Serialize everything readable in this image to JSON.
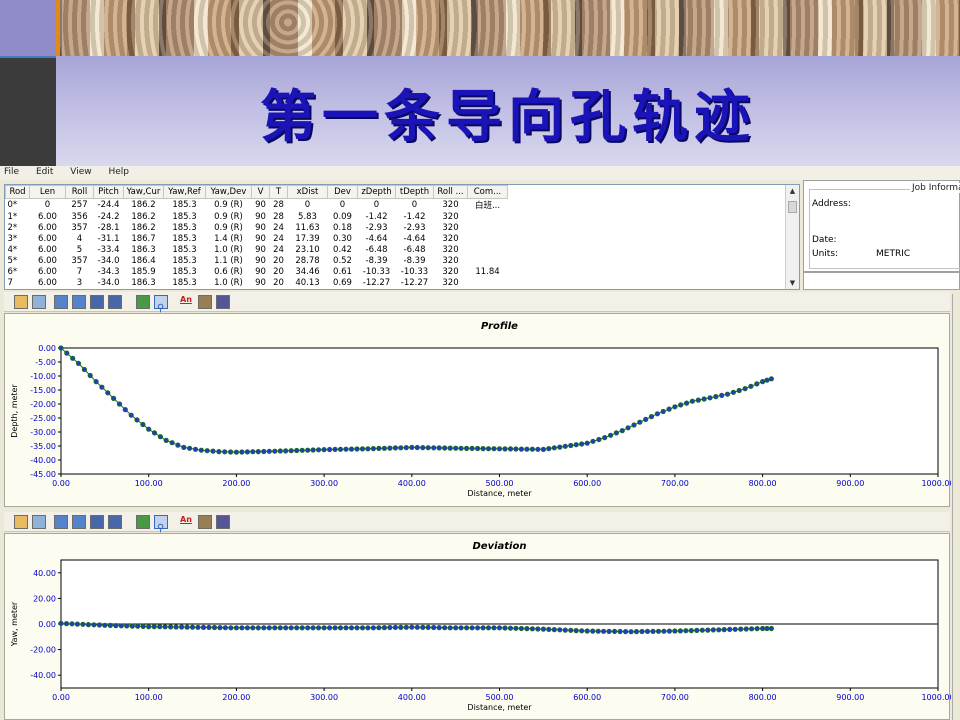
{
  "slide": {
    "title": "第一条导向孔轨迹"
  },
  "menu": {
    "items": [
      "File",
      "Edit",
      "View",
      "Help"
    ]
  },
  "grid": {
    "columns": [
      "Rod",
      "Len",
      "Roll",
      "Pitch",
      "Yaw,Cur",
      "Yaw,Ref",
      "Yaw,Dev",
      "V",
      "T",
      "xDist",
      "Dev",
      "zDepth",
      "tDepth",
      "Roll ...",
      "Com..."
    ],
    "rows": [
      [
        "0*",
        "0",
        "257",
        "-24.4",
        "186.2",
        "185.3",
        "0.9 (R)",
        "90",
        "28",
        "0",
        "0",
        "0",
        "0",
        "320",
        "白班..."
      ],
      [
        "1*",
        "6.00",
        "356",
        "-24.2",
        "186.2",
        "185.3",
        "0.9 (R)",
        "90",
        "28",
        "5.83",
        "0.09",
        "-1.42",
        "-1.42",
        "320",
        ""
      ],
      [
        "2*",
        "6.00",
        "357",
        "-28.1",
        "186.2",
        "185.3",
        "0.9 (R)",
        "90",
        "24",
        "11.63",
        "0.18",
        "-2.93",
        "-2.93",
        "320",
        ""
      ],
      [
        "3*",
        "6.00",
        "4",
        "-31.1",
        "186.7",
        "185.3",
        "1.4 (R)",
        "90",
        "24",
        "17.39",
        "0.30",
        "-4.64",
        "-4.64",
        "320",
        ""
      ],
      [
        "4*",
        "6.00",
        "5",
        "-33.4",
        "186.3",
        "185.3",
        "1.0 (R)",
        "90",
        "24",
        "23.10",
        "0.42",
        "-6.48",
        "-6.48",
        "320",
        ""
      ],
      [
        "5*",
        "6.00",
        "357",
        "-34.0",
        "186.4",
        "185.3",
        "1.1 (R)",
        "90",
        "20",
        "28.78",
        "0.52",
        "-8.39",
        "-8.39",
        "320",
        ""
      ],
      [
        "6*",
        "6.00",
        "7",
        "-34.3",
        "185.9",
        "185.3",
        "0.6 (R)",
        "90",
        "20",
        "34.46",
        "0.61",
        "-10.33",
        "-10.33",
        "320",
        "11.84"
      ],
      [
        "7",
        "6.00",
        "3",
        "-34.0",
        "186.3",
        "185.3",
        "1.0 (R)",
        "90",
        "20",
        "40.13",
        "0.69",
        "-12.27",
        "-12.27",
        "320",
        ""
      ]
    ]
  },
  "job_info": {
    "legend": "Job Informa",
    "address_label": "Address:",
    "date_label": "Date:",
    "units_label": "Units:",
    "units_value": "METRIC"
  },
  "toolbar": {
    "icons": [
      "folder-open-icon",
      "copy-icon",
      "grid-view-icon",
      "grid-view2-icon",
      "table-icon",
      "table2-icon",
      "export-icon",
      "zoom-icon",
      "annotate-icon",
      "hammer-icon",
      "binoculars-icon"
    ],
    "annotate_label": "An"
  },
  "colors": {
    "series_fill": "#1e3fbf",
    "series_stroke": "#1a6b1a",
    "tick_text": "#0000cc"
  },
  "chart_data": [
    {
      "type": "scatter",
      "title": "Profile",
      "xlabel": "Distance, meter",
      "ylabel": "Depth, meter",
      "xlim": [
        0,
        1000
      ],
      "ylim": [
        -45,
        0
      ],
      "x_ticks": [
        "0.00",
        "100.00",
        "200.00",
        "300.00",
        "400.00",
        "500.00",
        "600.00",
        "700.00",
        "800.00",
        "900.00",
        "1000.00"
      ],
      "y_ticks": [
        "0.00",
        "-5.00",
        "-10.00",
        "-15.00",
        "-20.00",
        "-25.00",
        "-30.00",
        "-35.00",
        "-40.00",
        "-45.00"
      ],
      "series": [
        {
          "x": [
            0,
            20,
            40,
            60,
            80,
            100,
            120,
            140,
            160,
            180,
            200,
            250,
            300,
            350,
            400,
            450,
            500,
            550,
            600,
            620,
            640,
            660,
            680,
            700,
            720,
            740,
            760,
            780,
            800,
            810
          ],
          "y": [
            0,
            -5.5,
            -12,
            -18,
            -24,
            -29,
            -33,
            -35.5,
            -36.5,
            -37,
            -37.2,
            -36.8,
            -36.3,
            -36,
            -35.5,
            -35.8,
            -36,
            -36.2,
            -34,
            -32,
            -29.5,
            -26.5,
            -23.5,
            -21,
            -19,
            -17.8,
            -16.5,
            -14.5,
            -12,
            -11
          ]
        }
      ]
    },
    {
      "type": "scatter",
      "title": "Deviation",
      "xlabel": "Distance, meter",
      "ylabel": "Yaw, meter",
      "xlim": [
        0,
        1000
      ],
      "ylim": [
        -50,
        50
      ],
      "x_ticks": [
        "0.00",
        "100.00",
        "200.00",
        "300.00",
        "400.00",
        "500.00",
        "600.00",
        "700.00",
        "800.00",
        "900.00",
        "1000.00"
      ],
      "y_ticks": [
        "40.00",
        "20.00",
        "0.00",
        "-20.00",
        "-40.00"
      ],
      "series": [
        {
          "x": [
            0,
            50,
            100,
            150,
            200,
            250,
            300,
            350,
            400,
            450,
            500,
            550,
            600,
            650,
            700,
            750,
            800,
            810
          ],
          "y": [
            0.5,
            -1,
            -2,
            -2.5,
            -3,
            -3,
            -3,
            -3,
            -2.5,
            -3,
            -3,
            -4,
            -5.5,
            -6,
            -5.5,
            -4.5,
            -3.5,
            -3.5
          ]
        }
      ]
    }
  ]
}
